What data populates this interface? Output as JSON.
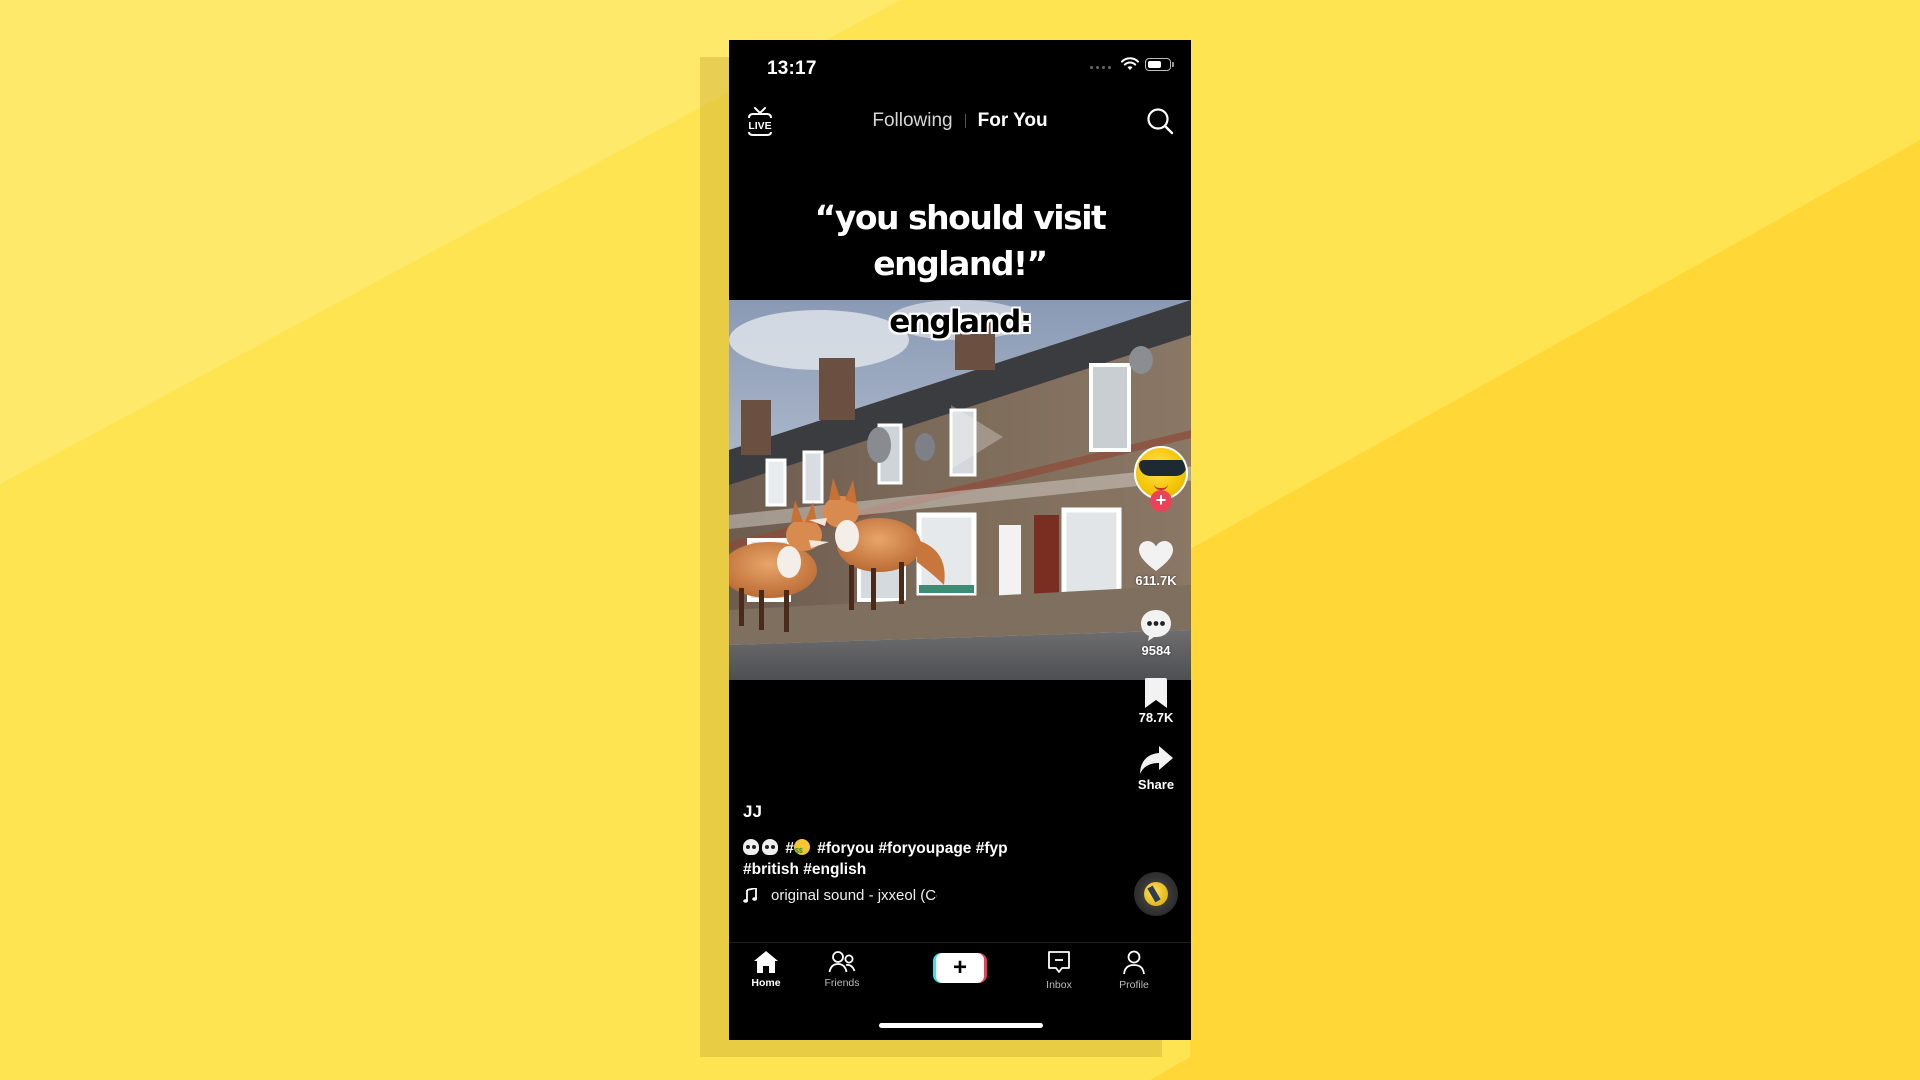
{
  "background": {
    "colors": {
      "light": "#FFE96A",
      "mid": "#FFE452",
      "deep": "#FFD838",
      "shadow": "#E6CC4A"
    }
  },
  "status_bar": {
    "time": "13:17",
    "signal_icon": "cellular-dots-icon",
    "wifi_icon": "wifi-icon",
    "battery_icon": "battery-icon",
    "battery_level": 0.7
  },
  "top_nav": {
    "live_icon": "live-tv-icon",
    "live_label": "LIVE",
    "tabs": [
      {
        "label": "Following",
        "active": false
      },
      {
        "label": "For You",
        "active": true
      }
    ],
    "search_icon": "search-icon"
  },
  "video": {
    "caption_top_lines": [
      "“you should visit",
      "england!”"
    ],
    "caption_overlay": "england:",
    "play_icon": "play-icon"
  },
  "actions": {
    "avatar_icon": "sunglasses-emoji-avatar",
    "follow_icon": "plus-icon",
    "likes": "611.7K",
    "comments": "9584",
    "saves": "78.7K",
    "share_label": "Share",
    "disc_icon": "music-disc-icon"
  },
  "post": {
    "username": "JJ",
    "description_prefix_emoji": [
      "skull",
      "skull"
    ],
    "hash_emoji": "#",
    "hashtags_line1": [
      "#foryou",
      "#foryoupage",
      "#fyp"
    ],
    "hashtags_line2": [
      "#british",
      "#english"
    ],
    "sound_icon": "music-note-icon",
    "sound": "original sound - jxxeol (Co"
  },
  "bottom_nav": {
    "items": [
      {
        "label": "Home",
        "icon": "home-icon",
        "active": true
      },
      {
        "label": "Friends",
        "icon": "friends-icon",
        "active": false
      },
      {
        "label": "",
        "icon": "create-plus-icon",
        "active": false
      },
      {
        "label": "Inbox",
        "icon": "inbox-icon",
        "active": false
      },
      {
        "label": "Profile",
        "icon": "profile-icon",
        "active": false
      }
    ],
    "create_symbol": "+"
  },
  "accent_colors": {
    "tiktok_red": "#EA4359",
    "tiktok_cyan": "#3EE0E8",
    "text": "#FFFFFF"
  }
}
